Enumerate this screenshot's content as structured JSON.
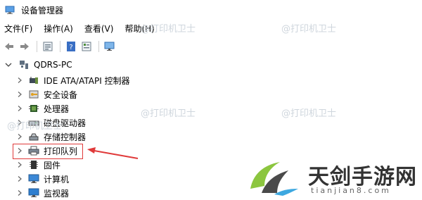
{
  "window": {
    "title": "设备管理器"
  },
  "menus": [
    {
      "label": "文件(F)"
    },
    {
      "label": "操作(A)"
    },
    {
      "label": "查看(V)"
    },
    {
      "label": "帮助(H)"
    }
  ],
  "toolbar": {
    "buttons": [
      "back-icon",
      "forward-icon",
      "properties-icon",
      "help-icon",
      "view-icon",
      "monitor-icon"
    ]
  },
  "tree": {
    "root": {
      "label": "QDRS-PC"
    },
    "items": [
      {
        "label": "IDE ATA/ATAPI 控制器",
        "icon": "ide-controller-icon"
      },
      {
        "label": "安全设备",
        "icon": "security-device-icon"
      },
      {
        "label": "处理器",
        "icon": "processor-icon"
      },
      {
        "label": "磁盘驱动器",
        "icon": "disk-drive-icon"
      },
      {
        "label": "存储控制器",
        "icon": "storage-controller-icon"
      },
      {
        "label": "打印队列",
        "icon": "printer-icon"
      },
      {
        "label": "固件",
        "icon": "firmware-icon"
      },
      {
        "label": "计算机",
        "icon": "computer-icon"
      },
      {
        "label": "监视器",
        "icon": "monitor-icon"
      }
    ]
  },
  "watermarks": [
    "@打印机卫士",
    "@打印机卫士",
    "@打印机卫士",
    "@打印机卫士",
    "@打印机卫士"
  ],
  "logo": {
    "main": "天剑手游网",
    "sub": "tianjian8.com"
  },
  "colors": {
    "highlight": "#e03a3a",
    "arrow": "#e03a3a"
  }
}
